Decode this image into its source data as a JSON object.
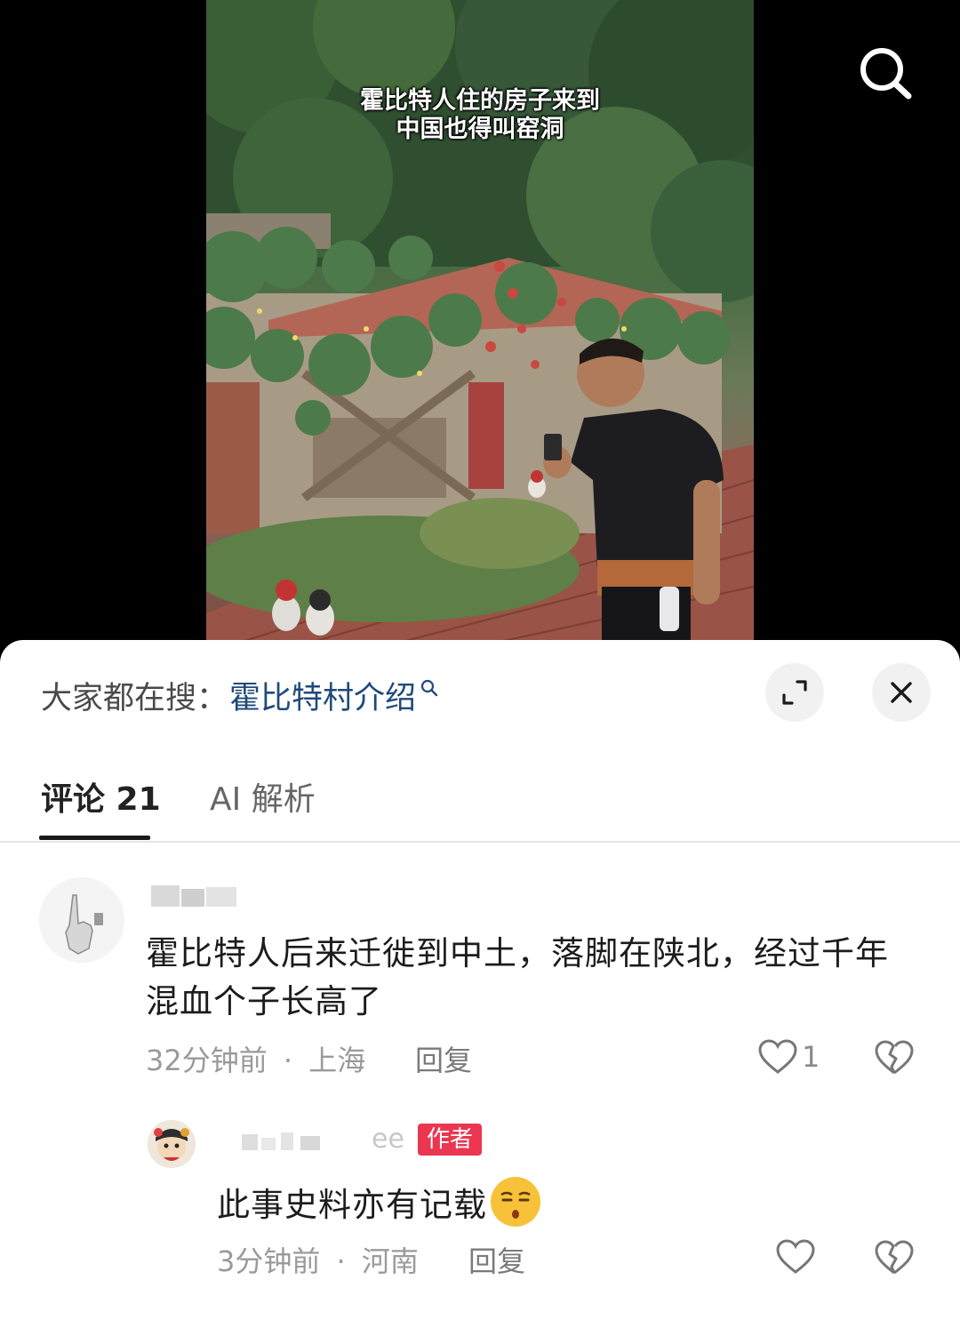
{
  "video": {
    "caption_line1": "霍比特人住的房子来到",
    "caption_line2": "中国也得叫窑洞",
    "search_icon": "search-icon"
  },
  "sheet": {
    "suggest_label": "大家都在搜：",
    "suggest_query": "霍比特村介绍",
    "expand_icon": "expand-icon",
    "close_icon": "close-icon"
  },
  "tabs": [
    {
      "label": "评论 21",
      "active": true
    },
    {
      "label": "AI 解析",
      "active": false
    }
  ],
  "comments": [
    {
      "text": "霍比特人后来迁徙到中土，落脚在陕北，经过千年混血个子长高了",
      "time": "32分钟前",
      "location": "上海",
      "separator": "·",
      "reply": "回复",
      "likes": "1"
    }
  ],
  "reply": {
    "name_visible": "ee",
    "badge": "作者",
    "text": "此事史料亦有记载",
    "emoji": "smirk-emoji",
    "time": "3分钟前",
    "location": "河南",
    "separator": "·",
    "reply": "回复"
  },
  "colors": {
    "accent_link": "#1f4a7a",
    "author_badge": "#ea3650",
    "meta_text": "#9a9a9a"
  }
}
